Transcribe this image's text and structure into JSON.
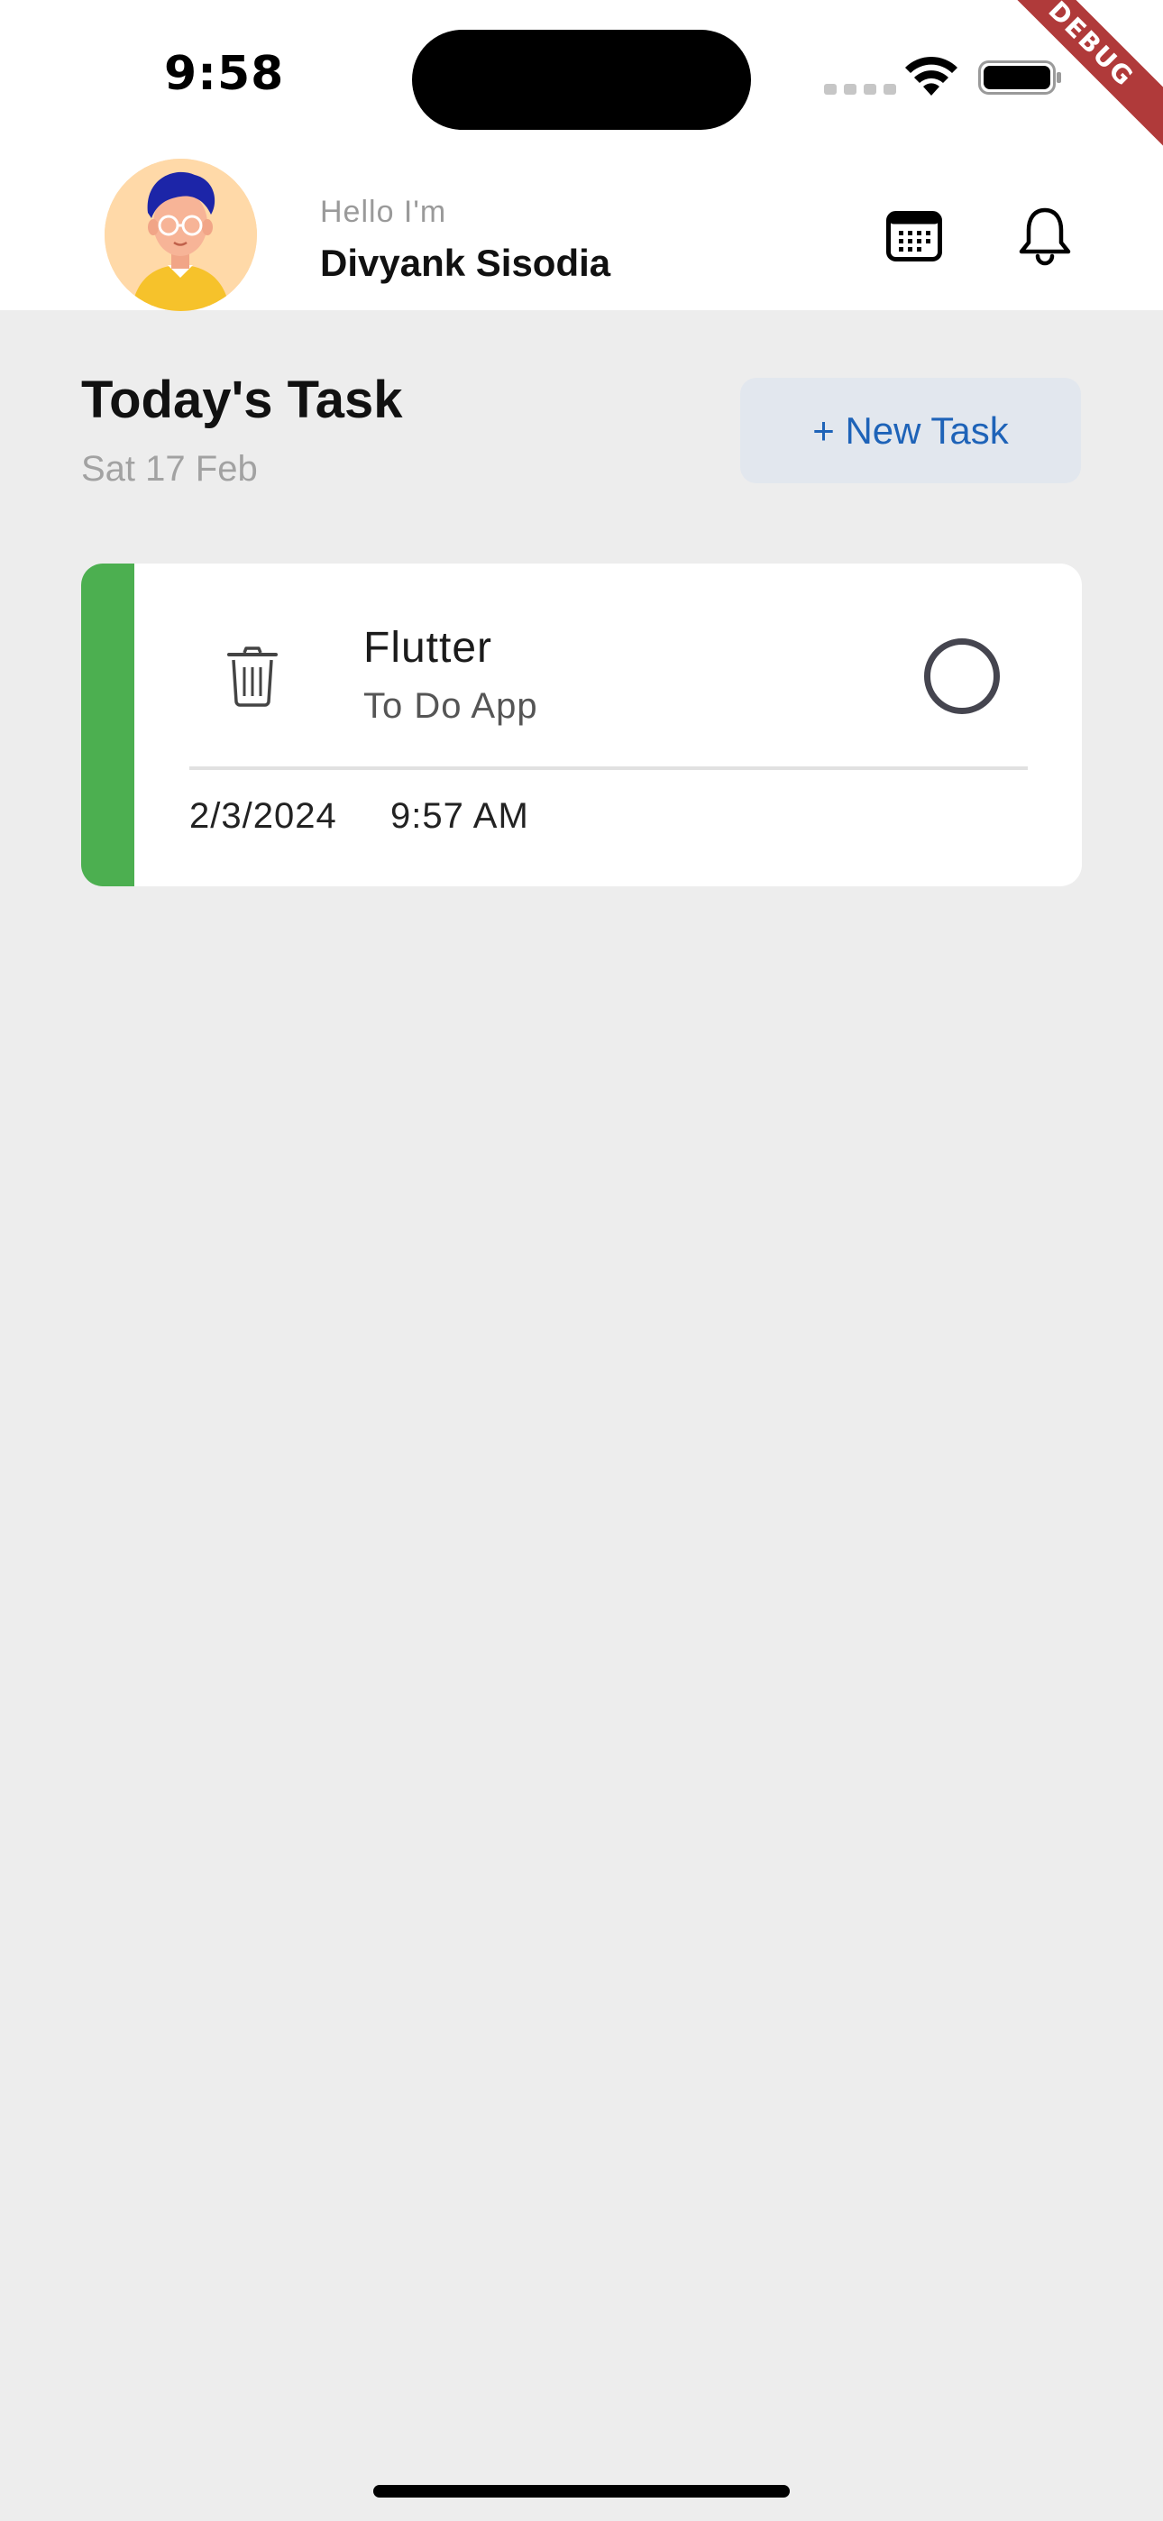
{
  "status_bar": {
    "time": "9:58",
    "debug_banner": "DEBUG"
  },
  "header": {
    "greeting": "Hello I'm",
    "user_name": "Divyank Sisodia",
    "avatar_icon": "user-avatar",
    "calendar_icon": "calendar-icon",
    "notification_icon": "bell-icon"
  },
  "main": {
    "title": "Today's Task",
    "date": "Sat 17 Feb",
    "new_task_label": "+ New Task"
  },
  "tasks": [
    {
      "title": "Flutter",
      "subtitle": "To Do App",
      "date": "2/3/2024",
      "time": "9:57 AM",
      "color": "#4caf50",
      "completed": false
    }
  ],
  "colors": {
    "background": "#ededed",
    "accent_blue": "#1e63b8",
    "button_bg": "#e2e7ee",
    "task_stripe": "#4caf50",
    "debug_banner": "#b03a3a"
  }
}
